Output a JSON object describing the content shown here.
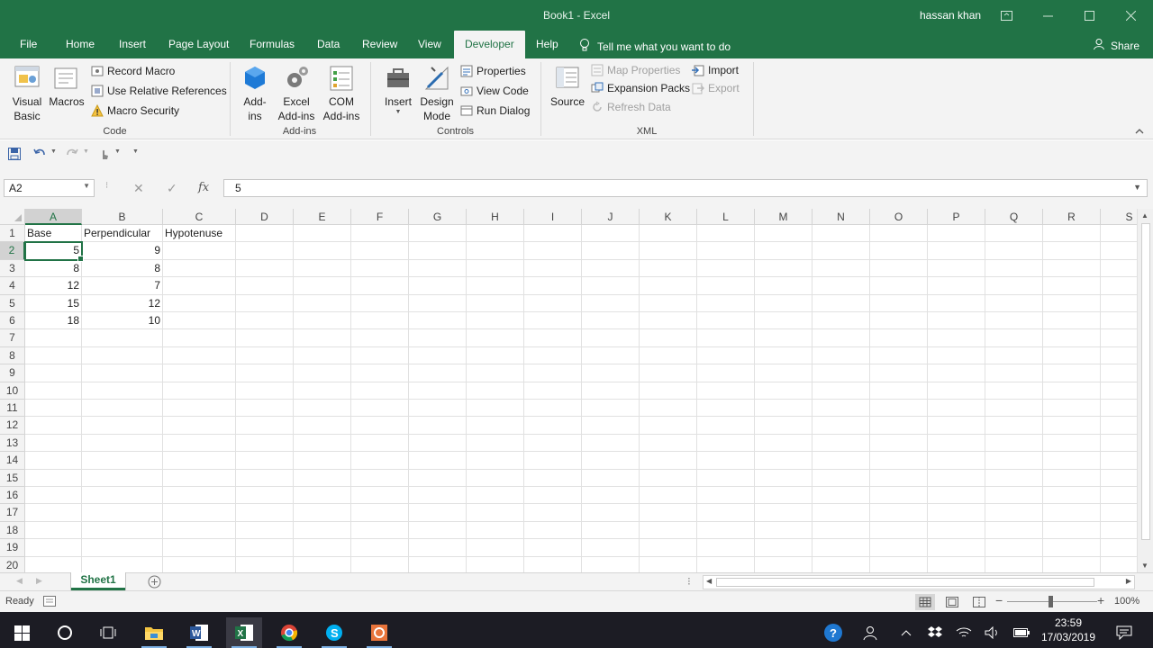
{
  "window": {
    "title": "Book1  -  Excel",
    "user": "hassan khan"
  },
  "tabs": [
    {
      "label": "File"
    },
    {
      "label": "Home"
    },
    {
      "label": "Insert"
    },
    {
      "label": "Page Layout"
    },
    {
      "label": "Formulas"
    },
    {
      "label": "Data"
    },
    {
      "label": "Review"
    },
    {
      "label": "View"
    },
    {
      "label": "Developer"
    },
    {
      "label": "Help"
    }
  ],
  "tell_me": "Tell me what you want to do",
  "share": "Share",
  "ribbon": {
    "code": {
      "label": "Code",
      "visual_basic": "Visual Basic",
      "macros": "Macros",
      "record_macro": "Record Macro",
      "use_relative": "Use Relative References",
      "macro_security": "Macro Security"
    },
    "addins": {
      "label": "Add-ins",
      "addins": "Add-ins",
      "excel_addins": "Excel Add-ins",
      "com_addins": "COM Add-ins"
    },
    "controls": {
      "label": "Controls",
      "insert": "Insert",
      "design_mode": "Design Mode",
      "properties": "Properties",
      "view_code": "View Code",
      "run_dialog": "Run Dialog"
    },
    "xml": {
      "label": "XML",
      "source": "Source",
      "map_properties": "Map Properties",
      "expansion_packs": "Expansion Packs",
      "refresh_data": "Refresh Data",
      "import": "Import",
      "export": "Export"
    }
  },
  "formula_bar": {
    "name_box": "A2",
    "fx": "fx",
    "value": "5"
  },
  "grid": {
    "columns": [
      "A",
      "B",
      "C",
      "D",
      "E",
      "F",
      "G",
      "H",
      "I",
      "J",
      "K",
      "L",
      "M",
      "N",
      "O",
      "P",
      "Q",
      "R",
      "S"
    ],
    "rows": [
      "1",
      "2",
      "3",
      "4",
      "5",
      "6",
      "7",
      "8",
      "9",
      "10",
      "11",
      "12",
      "13",
      "14",
      "15",
      "16",
      "17",
      "18",
      "19",
      "20"
    ],
    "cells": [
      [
        "Base",
        "Perpendicular",
        "Hypotenuse"
      ],
      [
        "5",
        "9",
        ""
      ],
      [
        "8",
        "8",
        ""
      ],
      [
        "12",
        "7",
        ""
      ],
      [
        "15",
        "12",
        ""
      ],
      [
        "18",
        "10",
        ""
      ]
    ],
    "active_cell": "A2"
  },
  "sheets": [
    {
      "label": "Sheet1"
    }
  ],
  "status": {
    "ready": "Ready",
    "zoom": "100%"
  },
  "clock": {
    "time": "23:59",
    "date": "17/03/2019"
  },
  "colors": {
    "accent": "#217346"
  }
}
